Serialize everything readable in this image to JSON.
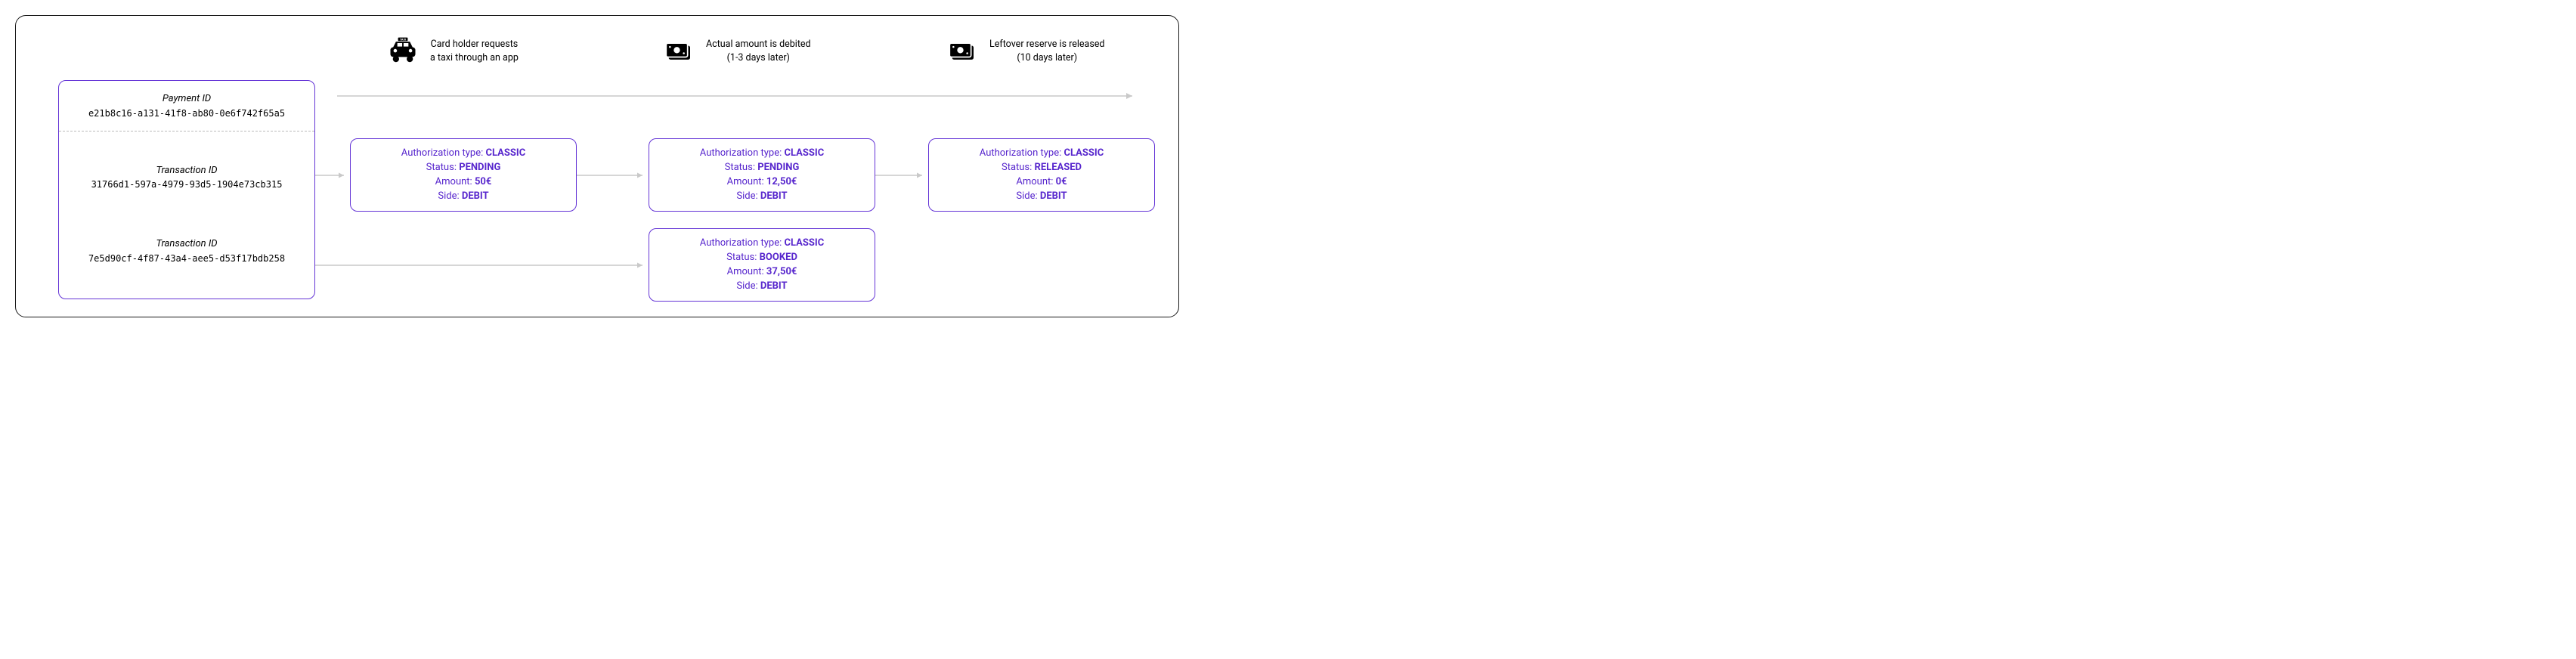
{
  "left_panel": {
    "payment_id_label": "Payment ID",
    "payment_id_value": "e21b8c16-a131-41f8-ab80-0e6f742f65a5",
    "transaction1_label": "Transaction ID",
    "transaction1_value": "31766d1-597a-4979-93d5-1904e73cb315",
    "transaction2_label": "Transaction ID",
    "transaction2_value": "7e5d90cf-4f87-43a4-aee5-d53f17bdb258"
  },
  "events": {
    "e1_line1": "Card holder requests",
    "e1_line2": "a taxi through an app",
    "e2_line1": "Actual amount is debited",
    "e2_line2": "(1-3 days later)",
    "e3_line1": "Leftover reserve is released",
    "e3_line2": "(10 days later)"
  },
  "labels": {
    "auth_type": "Authorization type: ",
    "status": "Status: ",
    "amount": "Amount: ",
    "side": "Side: "
  },
  "cards": {
    "c1": {
      "auth": "CLASSIC",
      "status": "PENDING",
      "amount": "50€",
      "side": "DEBIT"
    },
    "c2": {
      "auth": "CLASSIC",
      "status": "PENDING",
      "amount": "12,50€",
      "side": "DEBIT"
    },
    "c3": {
      "auth": "CLASSIC",
      "status": "RELEASED",
      "amount": "0€",
      "side": "DEBIT"
    },
    "c4": {
      "auth": "CLASSIC",
      "status": "BOOKED",
      "amount": "37,50€",
      "side": "DEBIT"
    }
  }
}
